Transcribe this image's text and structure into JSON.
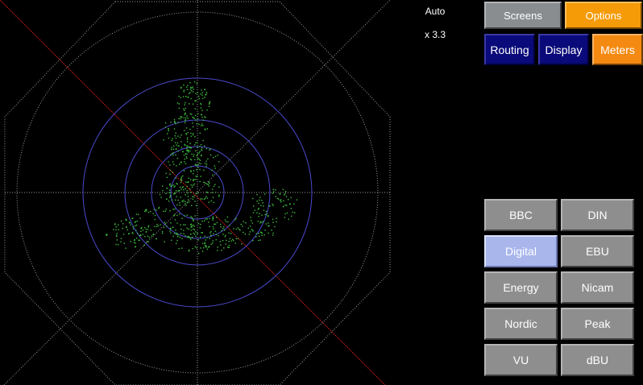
{
  "readouts": {
    "mode": "Auto",
    "zoom": "x 3.3"
  },
  "top_tabs": {
    "screens": "Screens",
    "options": "Options"
  },
  "sub_tabs": {
    "routing": "Routing",
    "display": "Display",
    "meters": "Meters"
  },
  "meter_types": [
    "BBC",
    "DIN",
    "Digital",
    "EBU",
    "Energy",
    "Nicam",
    "Nordic",
    "Peak",
    "VU",
    "dBU"
  ],
  "selected_meter": "Digital",
  "colors": {
    "trace": "#3fbf3f",
    "grid": "#9a9a9a",
    "rings": "#4a4acc",
    "diagonal_red": "#c21818",
    "accent_orange": "#f59b08"
  }
}
